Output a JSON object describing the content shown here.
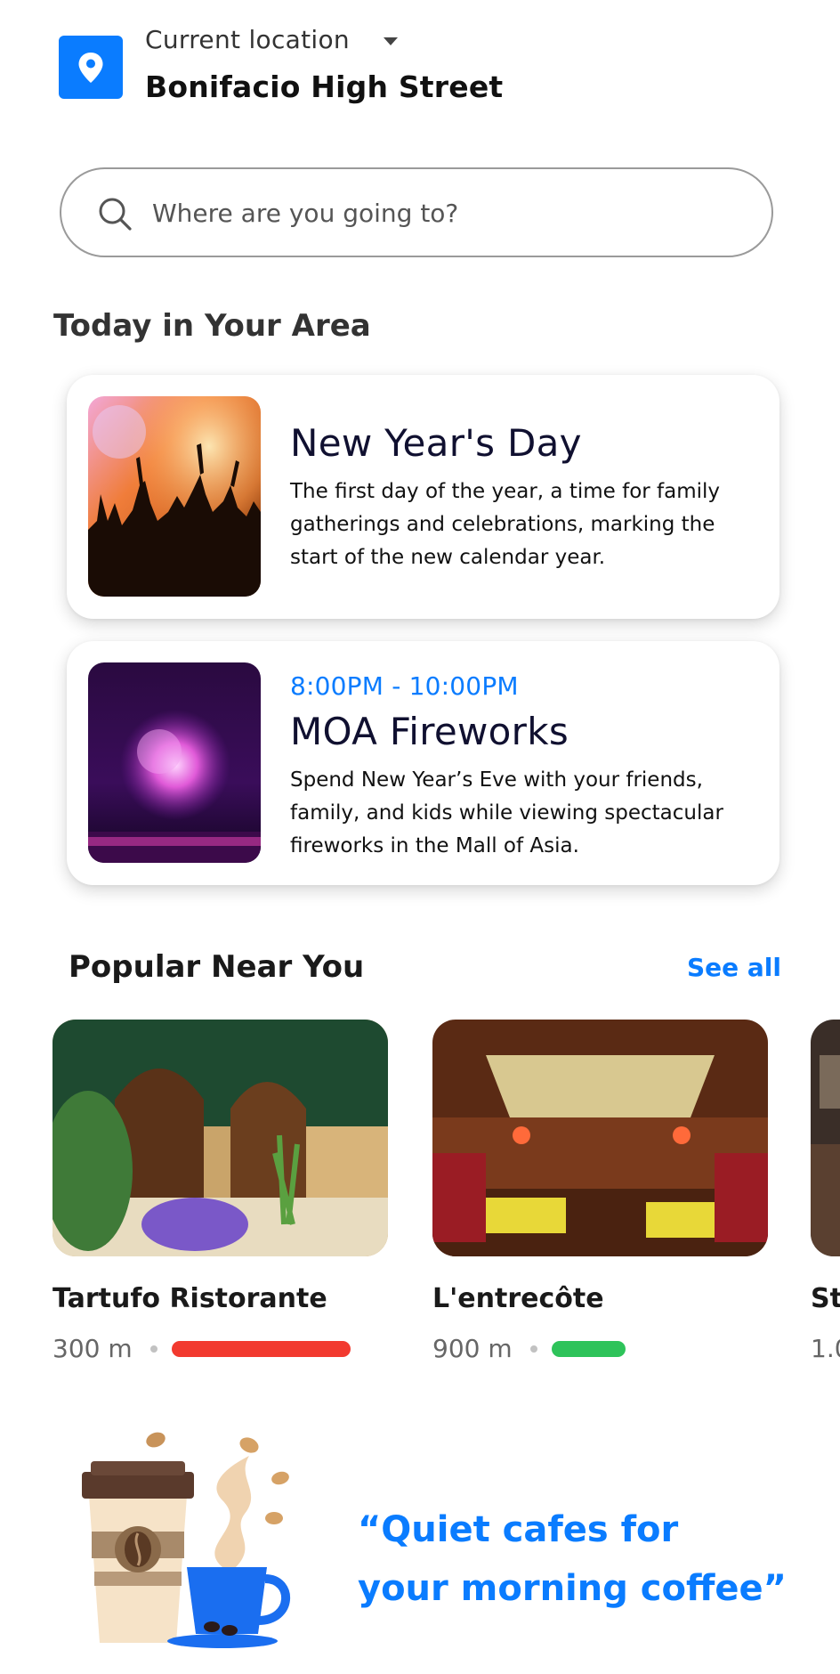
{
  "header": {
    "location_label": "Current location",
    "location_name": "Bonifacio High Street"
  },
  "search": {
    "placeholder": "Where are you going to?"
  },
  "today": {
    "title": "Today in Your Area",
    "cards": [
      {
        "title": "New Year's Day",
        "description": "The first day of the year, a time for family gatherings and celebrations, marking the start of the new calendar year."
      },
      {
        "time": "8:00PM - 10:00PM",
        "title": "MOA Fireworks",
        "description": "Spend New Year’s Eve with your friends, family, and kids while viewing spectacular fireworks in the Mall of Asia."
      }
    ]
  },
  "popular": {
    "title": "Popular Near You",
    "see_all": "See all",
    "places": [
      {
        "name": "Tartufo Ristorante",
        "distance": "300 m",
        "crowd_level": 0.85,
        "crowd_color": "#f23a2f"
      },
      {
        "name": "L'entrecôte",
        "distance": "900 m",
        "crowd_level": 0.35,
        "crowd_color": "#2ec35a"
      },
      {
        "name": "St",
        "distance": "1.0"
      }
    ]
  },
  "promo": {
    "line1": "“Quiet cafes for",
    "line2": "your morning coffee”"
  },
  "colors": {
    "accent": "#0a7cff",
    "busy": "#f23a2f",
    "quiet": "#2ec35a"
  },
  "icons": {
    "location": "map-pin-icon",
    "dropdown": "caret-down-icon",
    "search": "search-icon"
  }
}
